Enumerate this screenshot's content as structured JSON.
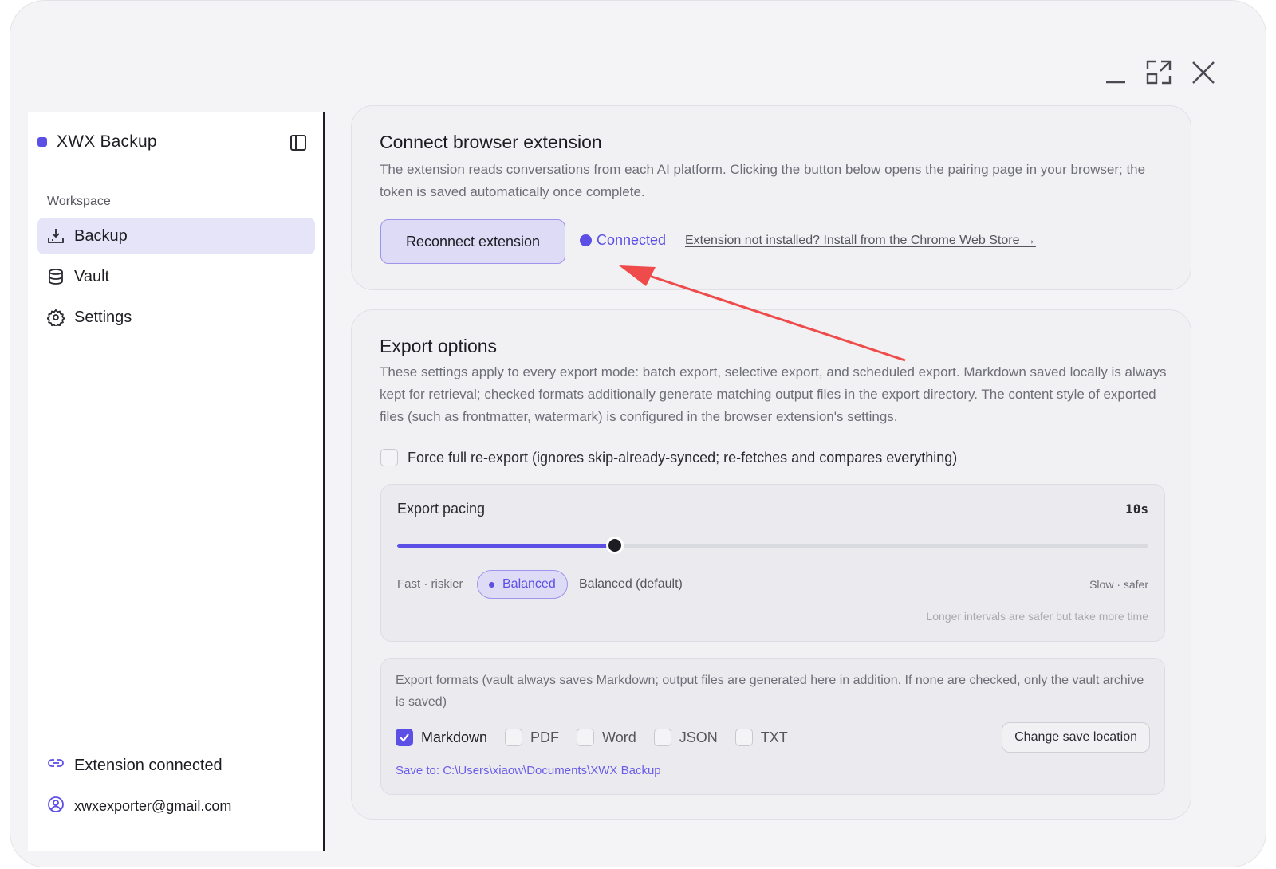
{
  "window": {
    "controls": {
      "minimize": "minimize-icon",
      "maximize": "maximize-icon",
      "close": "close-icon"
    }
  },
  "sidebar": {
    "brand": "XWX Backup",
    "accent_color": "#5b4fe6",
    "section_label": "Workspace",
    "items": [
      {
        "label": "Backup",
        "icon": "upload-tray-icon",
        "active": true
      },
      {
        "label": "Vault",
        "icon": "database-icon",
        "active": false
      },
      {
        "label": "Settings",
        "icon": "gear-icon",
        "active": false
      }
    ],
    "footer": {
      "extension_status": "Extension connected",
      "account_email": "xwxexporter@gmail.com"
    }
  },
  "connect_card": {
    "title": "Connect browser extension",
    "description": "The extension reads conversations from each AI platform. Clicking the button below opens the pairing page in your browser; the token is saved automatically once complete.",
    "button_label": "Reconnect extension",
    "status": "Connected",
    "install_link": "Extension not installed? Install from the Chrome Web Store →"
  },
  "export_card": {
    "title": "Export options",
    "description": "These settings apply to every export mode: batch export, selective export, and scheduled export. Markdown saved locally is always kept for retrieval; checked formats additionally generate matching output files in the export directory. The content style of exported files (such as frontmatter, watermark) is configured in the browser extension's settings.",
    "force_reexport": {
      "label": "Force full re-export (ignores skip-already-synced; re-fetches and compares everything)",
      "checked": false
    },
    "pacing": {
      "title": "Export pacing",
      "value": "10s",
      "slider_fraction": 0.29,
      "left_label": "Fast · riskier",
      "chip_label": "Balanced",
      "default_label": "Balanced (default)",
      "right_label": "Slow · safer",
      "hint": "Longer intervals are safer but take more time"
    },
    "formats": {
      "description": "Export formats (vault always saves Markdown; output files are generated here in addition. If none are checked, only the vault archive is saved)",
      "options": [
        {
          "label": "Markdown",
          "checked": true
        },
        {
          "label": "PDF",
          "checked": false
        },
        {
          "label": "Word",
          "checked": false
        },
        {
          "label": "JSON",
          "checked": false
        },
        {
          "label": "TXT",
          "checked": false
        }
      ],
      "change_button": "Change save location",
      "save_path": "Save to: C:\\Users\\xiaow\\Documents\\XWX Backup"
    }
  },
  "annotation": {
    "arrow_color": "#ef4b4b"
  }
}
